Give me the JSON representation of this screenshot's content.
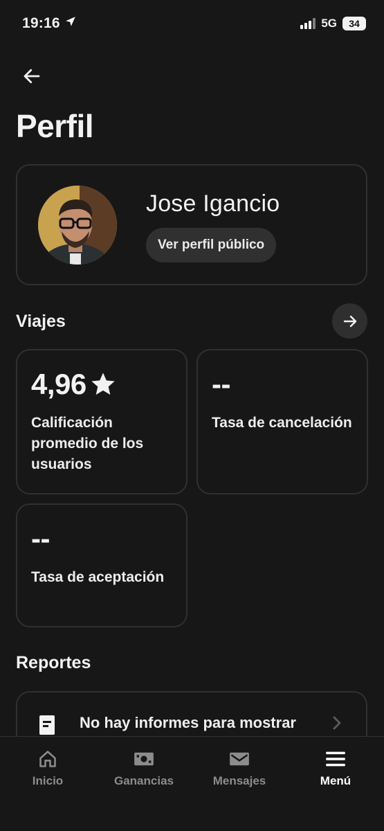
{
  "status_bar": {
    "time": "19:16",
    "network": "5G",
    "battery": "34",
    "location_icon": "location-arrow-icon",
    "signal_icon": "cellular-signal-icon"
  },
  "header": {
    "back_icon": "arrow-left-icon",
    "title": "Perfil"
  },
  "profile": {
    "name": "Jose Igancio",
    "public_profile_label": "Ver perfil público"
  },
  "trips": {
    "title": "Viajes",
    "arrow_icon": "arrow-right-icon",
    "stats": [
      {
        "value": "4,96",
        "label": "Calificación promedio de los usuarios",
        "icon": "star-icon"
      },
      {
        "value": "--",
        "label": "Tasa de cancelación"
      },
      {
        "value": "--",
        "label": "Tasa de aceptación"
      }
    ]
  },
  "reports": {
    "title": "Reportes",
    "empty_text": "No hay informes para mostrar",
    "icon": "document-icon",
    "chevron_icon": "chevron-right-icon"
  },
  "tab_bar": {
    "items": [
      {
        "label": "Inicio",
        "icon": "home-icon"
      },
      {
        "label": "Ganancias",
        "icon": "money-icon"
      },
      {
        "label": "Mensajes",
        "icon": "mail-icon"
      },
      {
        "label": "Menú",
        "icon": "menu-icon"
      }
    ],
    "active": "Menú"
  },
  "colors": {
    "background": "#171717",
    "card_border": "#303030",
    "button_bg": "#303030",
    "text_primary": "#f2f2f2",
    "tab_inactive": "#8c8c8c"
  }
}
